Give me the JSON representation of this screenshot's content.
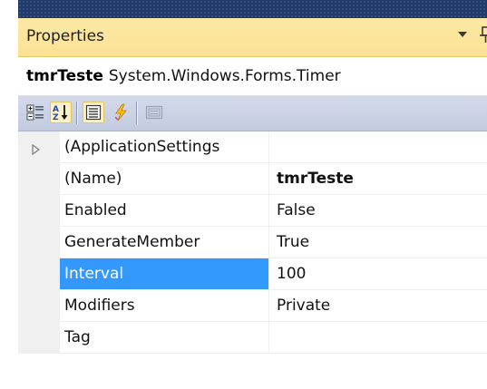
{
  "window": {
    "title": "Properties",
    "object_name": "tmrTeste",
    "object_type": "System.Windows.Forms.Timer"
  },
  "toolbar": {
    "buttons": [
      {
        "name": "categorized",
        "icon": "categorized-icon",
        "active": false
      },
      {
        "name": "alphabetical",
        "icon": "alphabetical-sort-icon",
        "active": true
      },
      {
        "name": "properties",
        "icon": "properties-icon",
        "active": true
      },
      {
        "name": "events",
        "icon": "events-lightning-icon",
        "active": false
      },
      {
        "name": "property-pages",
        "icon": "property-pages-icon",
        "active": false
      }
    ]
  },
  "grid": {
    "rows": [
      {
        "name": "(ApplicationSettings",
        "value": "",
        "expandable": true
      },
      {
        "name": "(Name)",
        "value": "tmrTeste",
        "bold": true
      },
      {
        "name": "Enabled",
        "value": "False"
      },
      {
        "name": "GenerateMember",
        "value": "True"
      },
      {
        "name": "Interval",
        "value": "100",
        "selected": true
      },
      {
        "name": "Modifiers",
        "value": "Private"
      },
      {
        "name": "Tag",
        "value": ""
      }
    ]
  },
  "colors": {
    "titlebar": "#fde9a4",
    "selection": "#3399ff",
    "toolbar": "#ccd3e6",
    "outer_frame": "#233a66"
  }
}
